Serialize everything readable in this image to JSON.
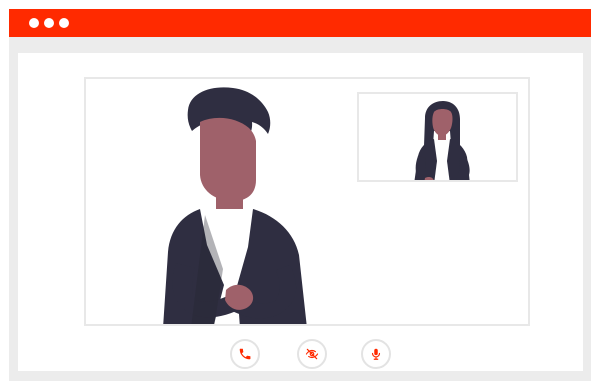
{
  "window": {
    "accent_color": "#ff2a00",
    "dots": [
      "window-dot",
      "window-dot",
      "window-dot"
    ]
  },
  "call": {
    "main_participant": {
      "avatar": "man-avatar"
    },
    "pip_participant": {
      "avatar": "woman-avatar"
    },
    "controls": [
      {
        "icon": "phone-icon",
        "state": "active"
      },
      {
        "icon": "eye-off-icon",
        "state": "active"
      },
      {
        "icon": "microphone-icon",
        "state": "active"
      }
    ]
  }
}
